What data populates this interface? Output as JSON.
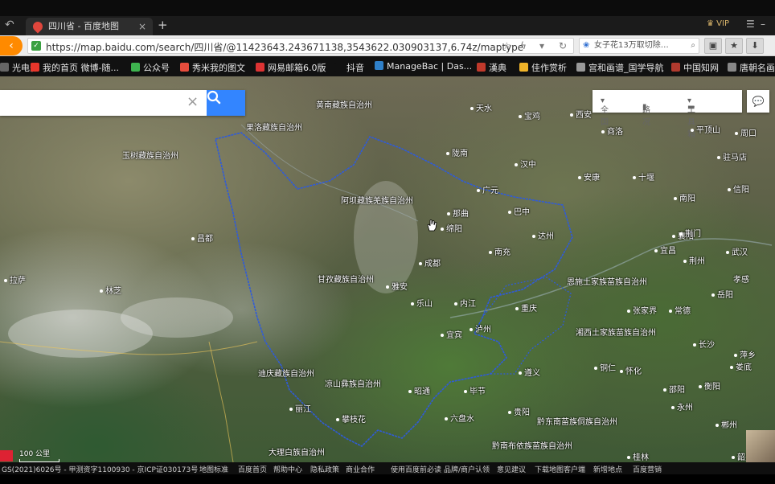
{
  "browser": {
    "tab_title": "四川省 - 百度地图",
    "tab_close": "×",
    "new_tab": "+",
    "vip": "VIP",
    "url": "https://map.baidu.com/search/四川省/@11423643.243671138,3543622.030903137,6.74z/maptype",
    "search_text": "女子花13万取切除…",
    "bookmarks": [
      {
        "label": "光电影",
        "color": "#666666"
      },
      {
        "label": "我的首页 微博-随...",
        "color": "#e8362b"
      },
      {
        "label": "公众号",
        "color": "#3eb34f"
      },
      {
        "label": "秀米我的图文",
        "color": "#e74c3c"
      },
      {
        "label": "网易邮箱6.0版",
        "color": "#d33"
      },
      {
        "label": "抖音",
        "color": "#111111"
      },
      {
        "label": "ManageBac | Das...",
        "color": "#2f80c9"
      },
      {
        "label": "漢典",
        "color": "#c0392b"
      },
      {
        "label": "佳作赏析",
        "color": "#f0b429"
      },
      {
        "label": "宫和画谱_国学导航",
        "color": "#999999"
      },
      {
        "label": "中国知网",
        "color": "#b03a2e"
      },
      {
        "label": "唐朝名画",
        "color": "#888888"
      }
    ]
  },
  "map": {
    "search_placeholder": "",
    "clear_icon": "×",
    "tools": {
      "region": "全国",
      "traffic": "路况",
      "toolbox": "工具箱"
    },
    "scale_label": "100 公里",
    "labels": [
      {
        "text": "黄南藏族自治州",
        "dot": false
      },
      {
        "text": "天水",
        "dot": true
      },
      {
        "text": "宝鸡",
        "dot": true
      },
      {
        "text": "西安",
        "dot": true
      },
      {
        "text": "商洛",
        "dot": true
      },
      {
        "text": "平顶山",
        "dot": true
      },
      {
        "text": "周口",
        "dot": true
      },
      {
        "text": "果洛藏族自治州",
        "dot": false
      },
      {
        "text": "玉树藏族自治州",
        "dot": false
      },
      {
        "text": "陇南",
        "dot": true
      },
      {
        "text": "汉中",
        "dot": true
      },
      {
        "text": "安康",
        "dot": true
      },
      {
        "text": "十堰",
        "dot": true
      },
      {
        "text": "南阳",
        "dot": true
      },
      {
        "text": "驻马店",
        "dot": true
      },
      {
        "text": "信阳",
        "dot": true
      },
      {
        "text": "广元",
        "dot": true
      },
      {
        "text": "阿坝藏族羌族自治州",
        "dot": false
      },
      {
        "text": "襄阳",
        "dot": true
      },
      {
        "text": "那曲",
        "dot": true
      },
      {
        "text": "巴中",
        "dot": true
      },
      {
        "text": "绵阳",
        "dot": true
      },
      {
        "text": "达州",
        "dot": true
      },
      {
        "text": "昌都",
        "dot": true
      },
      {
        "text": "荆门",
        "dot": true
      },
      {
        "text": "宜昌",
        "dot": true
      },
      {
        "text": "荆州",
        "dot": true
      },
      {
        "text": "武汉",
        "dot": true
      },
      {
        "text": "成都",
        "dot": true
      },
      {
        "text": "南充",
        "dot": true
      },
      {
        "text": "拉萨",
        "dot": true
      },
      {
        "text": "林芝",
        "dot": true
      },
      {
        "text": "甘孜藏族自治州",
        "dot": false
      },
      {
        "text": "雅安",
        "dot": true
      },
      {
        "text": "恩施土家族苗族自治州",
        "dot": false
      },
      {
        "text": "孝感",
        "dot": false
      },
      {
        "text": "内江",
        "dot": true
      },
      {
        "text": "乐山",
        "dot": true
      },
      {
        "text": "重庆",
        "dot": true
      },
      {
        "text": "张家界",
        "dot": true
      },
      {
        "text": "常德",
        "dot": true
      },
      {
        "text": "岳阳",
        "dot": true
      },
      {
        "text": "宜宾",
        "dot": true
      },
      {
        "text": "泸州",
        "dot": true
      },
      {
        "text": "湘西土家族苗族自治州",
        "dot": false
      },
      {
        "text": "长沙",
        "dot": true
      },
      {
        "text": "萍乡",
        "dot": true
      },
      {
        "text": "迪庆藏族自治州",
        "dot": false
      },
      {
        "text": "凉山彝族自治州",
        "dot": false
      },
      {
        "text": "遵义",
        "dot": true
      },
      {
        "text": "铜仁",
        "dot": true
      },
      {
        "text": "怀化",
        "dot": true
      },
      {
        "text": "娄底",
        "dot": true
      },
      {
        "text": "昭通",
        "dot": true
      },
      {
        "text": "毕节",
        "dot": true
      },
      {
        "text": "邵阳",
        "dot": true
      },
      {
        "text": "衡阳",
        "dot": true
      },
      {
        "text": "丽江",
        "dot": true
      },
      {
        "text": "攀枝花",
        "dot": true
      },
      {
        "text": "六盘水",
        "dot": true
      },
      {
        "text": "贵阳",
        "dot": true
      },
      {
        "text": "黔东南苗族侗族自治州",
        "dot": false
      },
      {
        "text": "永州",
        "dot": true
      },
      {
        "text": "郴州",
        "dot": true
      },
      {
        "text": "大理白族自治州",
        "dot": false
      },
      {
        "text": "黔南布依族苗族自治州",
        "dot": false
      },
      {
        "text": "桂林",
        "dot": true
      },
      {
        "text": "韶关",
        "dot": true
      }
    ]
  },
  "footer": {
    "links": [
      "GS(2021)6026号 - 甲测资字1100930 - 京ICP证030173号",
      "地图标准",
      "百度首页",
      "帮助中心",
      "隐私政策",
      "商业合作",
      "使用百度前必读",
      "品牌/商户认领",
      "意见建议",
      "下载地图客户端",
      "新增地点",
      "百度营销"
    ]
  }
}
